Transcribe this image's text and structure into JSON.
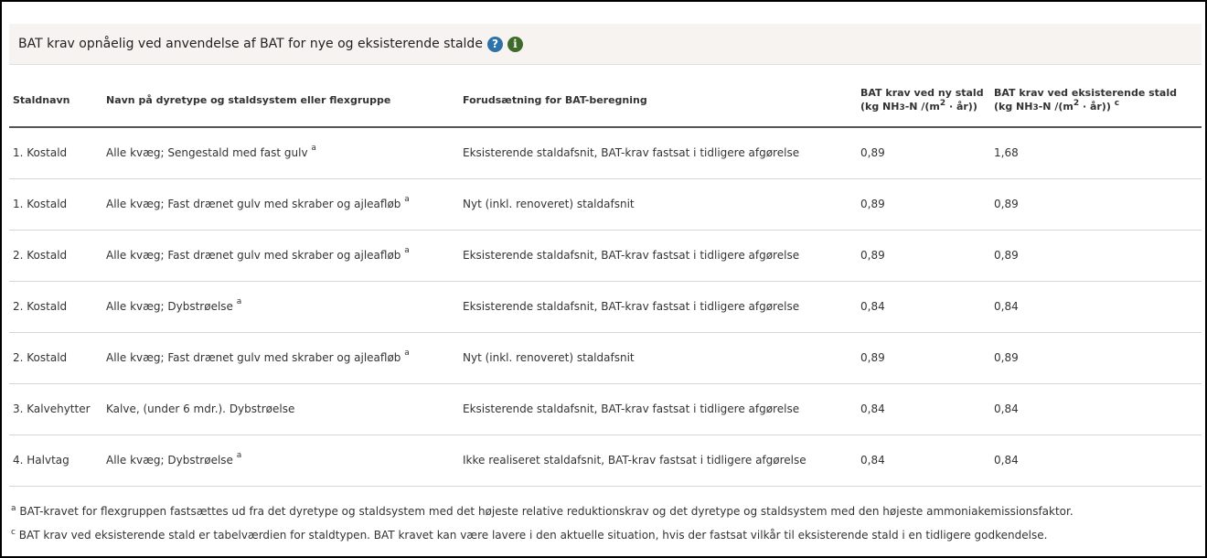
{
  "panel": {
    "title": "BAT krav opnåelig ved anvendelse af BAT for nye og eksisterende stalde",
    "help_icon": "question-mark-icon",
    "info_icon": "info-icon",
    "help_glyph": "?",
    "info_glyph": "i"
  },
  "table": {
    "headers": {
      "staldnavn": "Staldnavn",
      "navn": "Navn på dyretype og staldsystem eller flexgruppe",
      "forudsaetning": "Forudsætning for BAT-beregning",
      "ny_line1": "BAT krav ved ny stald",
      "eks_line1": "BAT krav ved eksisterende stald",
      "unit_a": "(kg NH",
      "unit_sub": "3",
      "unit_b": "-N /(m",
      "unit_sup": "2",
      "unit_c": " · år))",
      "eks_footnote": "c"
    },
    "rows": [
      {
        "staldnavn": "1. Kostald",
        "navn": "Alle kvæg; Sengestald med fast gulv",
        "fn": "a",
        "forudsaetning": "Eksisterende staldafsnit, BAT-krav fastsat i tidligere afgørelse",
        "ny": "0,89",
        "eks": "1,68"
      },
      {
        "staldnavn": "1. Kostald",
        "navn": "Alle kvæg; Fast drænet gulv med skraber og ajleafløb",
        "fn": "a",
        "forudsaetning": "Nyt (inkl. renoveret) staldafsnit",
        "ny": "0,89",
        "eks": "0,89"
      },
      {
        "staldnavn": "2. Kostald",
        "navn": "Alle kvæg; Fast drænet gulv med skraber og ajleafløb",
        "fn": "a",
        "forudsaetning": "Eksisterende staldafsnit, BAT-krav fastsat i tidligere afgørelse",
        "ny": "0,89",
        "eks": "0,89"
      },
      {
        "staldnavn": "2. Kostald",
        "navn": "Alle kvæg; Dybstrøelse",
        "fn": "a",
        "forudsaetning": "Eksisterende staldafsnit, BAT-krav fastsat i tidligere afgørelse",
        "ny": "0,84",
        "eks": "0,84"
      },
      {
        "staldnavn": "2. Kostald",
        "navn": "Alle kvæg; Fast drænet gulv med skraber og ajleafløb",
        "fn": "a",
        "forudsaetning": "Nyt (inkl. renoveret) staldafsnit",
        "ny": "0,89",
        "eks": "0,89"
      },
      {
        "staldnavn": "3. Kalvehytter",
        "navn": "Kalve, (under 6 mdr.). Dybstrøelse",
        "fn": "",
        "forudsaetning": "Eksisterende staldafsnit, BAT-krav fastsat i tidligere afgørelse",
        "ny": "0,84",
        "eks": "0,84"
      },
      {
        "staldnavn": "4. Halvtag",
        "navn": "Alle kvæg; Dybstrøelse",
        "fn": "a",
        "forudsaetning": "Ikke realiseret staldafsnit, BAT-krav fastsat i tidligere afgørelse",
        "ny": "0,84",
        "eks": "0,84"
      }
    ]
  },
  "footnotes": [
    {
      "mark": "a",
      "text": " BAT-kravet for flexgruppen fastsættes ud fra det dyretype og staldsystem med det højeste relative reduktionskrav og det dyretype og staldsystem med den højeste ammoniakemissionsfaktor."
    },
    {
      "mark": "c",
      "text": " BAT krav ved eksisterende stald er tabelværdien for staldtypen. BAT kravet kan være lavere i den aktuelle situation, hvis der fastsat vilkår til eksisterende stald i en tidligere godkendelse."
    }
  ]
}
